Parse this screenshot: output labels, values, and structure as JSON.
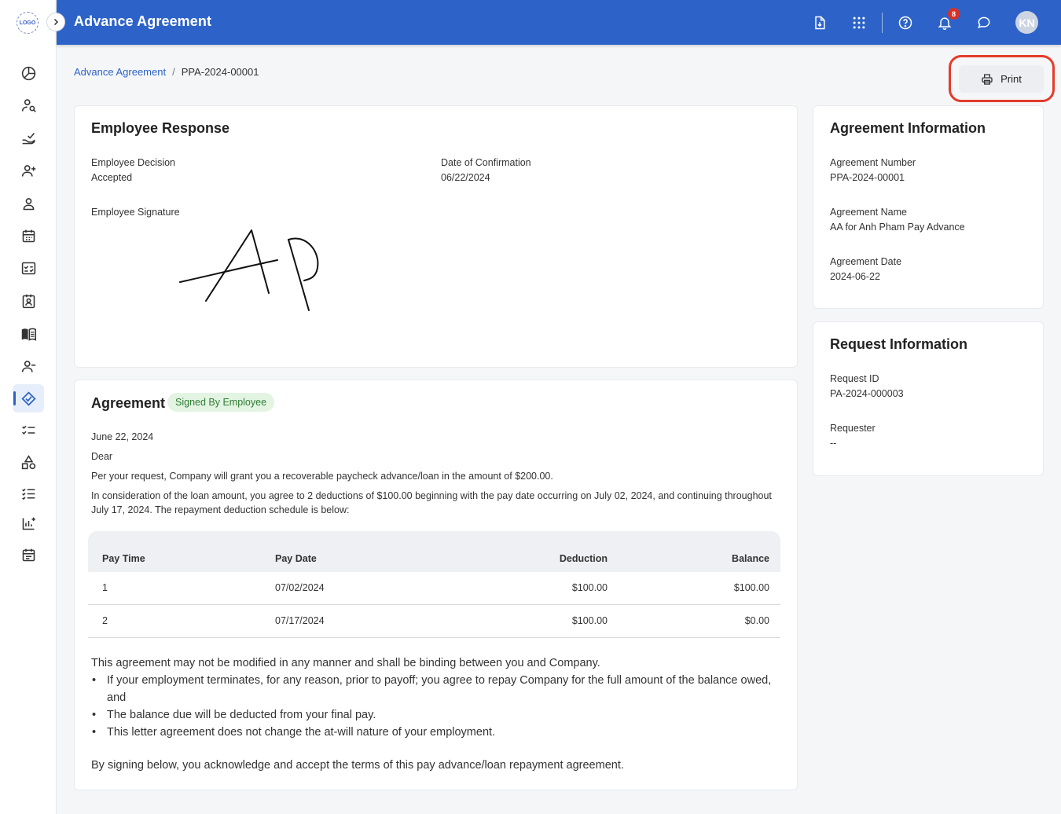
{
  "app": {
    "logo_text": "LOGO"
  },
  "sidebar": {
    "items": [
      {
        "icon": "dashboard-icon"
      },
      {
        "icon": "user-search-icon"
      },
      {
        "icon": "hand-check-icon"
      },
      {
        "icon": "user-add-icon"
      },
      {
        "icon": "user-icon"
      },
      {
        "icon": "calendar-icon"
      },
      {
        "icon": "checklist-board-icon"
      },
      {
        "icon": "contact-card-icon"
      },
      {
        "icon": "book-icon"
      },
      {
        "icon": "user-remove-icon"
      },
      {
        "icon": "pay-advance-icon",
        "active": true
      },
      {
        "icon": "task-list-icon"
      },
      {
        "icon": "shapes-icon"
      },
      {
        "icon": "numbered-list-icon"
      },
      {
        "icon": "report-chart-icon"
      },
      {
        "icon": "schedule-icon"
      }
    ]
  },
  "topbar": {
    "title": "Advance Agreement",
    "notification_count": "8",
    "avatar_initials": "KN",
    "accent_color": "#2d63c8"
  },
  "breadcrumb": {
    "parent": "Advance Agreement",
    "separator": "/",
    "current": "PPA-2024-00001"
  },
  "actions": {
    "print_label": "Print"
  },
  "employee_response": {
    "title": "Employee Response",
    "decision_label": "Employee Decision",
    "decision_value": "Accepted",
    "confirmation_label": "Date of Confirmation",
    "confirmation_value": "06/22/2024",
    "signature_label": "Employee Signature"
  },
  "agreement": {
    "title": "Agreement",
    "status": "Signed By Employee",
    "date": "June 22, 2024",
    "salutation": "Dear",
    "paragraph1": "Per your request, Company will grant you a recoverable paycheck advance/loan in the amount of $200.00.",
    "paragraph2": "In consideration of the loan amount, you agree to 2 deductions of $100.00 beginning with the pay date occurring on July 02, 2024, and continuing throughout July 17, 2024. The repayment deduction schedule is below:",
    "table": {
      "headers": [
        "Pay Time",
        "Pay Date",
        "Deduction",
        "Balance"
      ],
      "rows": [
        [
          "1",
          "07/02/2024",
          "$100.00",
          "$100.00"
        ],
        [
          "2",
          "07/17/2024",
          "$100.00",
          "$0.00"
        ]
      ]
    },
    "terms_intro": "This agreement may not be modified in any manner and shall be binding between you and Company.",
    "bullets": [
      "If your employment terminates, for any reason, prior to payoff; you agree to repay Company for the full amount of the balance owed, and",
      "The balance due will be deducted from your final pay.",
      "This letter agreement does not change the at-will nature of your employment."
    ],
    "closing": "By signing below, you acknowledge and accept the terms of this pay advance/loan repayment agreement."
  },
  "agreement_info": {
    "title": "Agreement Information",
    "number_label": "Agreement Number",
    "number_value": "PPA-2024-00001",
    "name_label": "Agreement Name",
    "name_value": "AA for Anh Pham Pay Advance",
    "date_label": "Agreement Date",
    "date_value": "2024-06-22"
  },
  "request_info": {
    "title": "Request Information",
    "id_label": "Request ID",
    "id_value": "PA-2024-000003",
    "requester_label": "Requester",
    "requester_value": "--"
  }
}
